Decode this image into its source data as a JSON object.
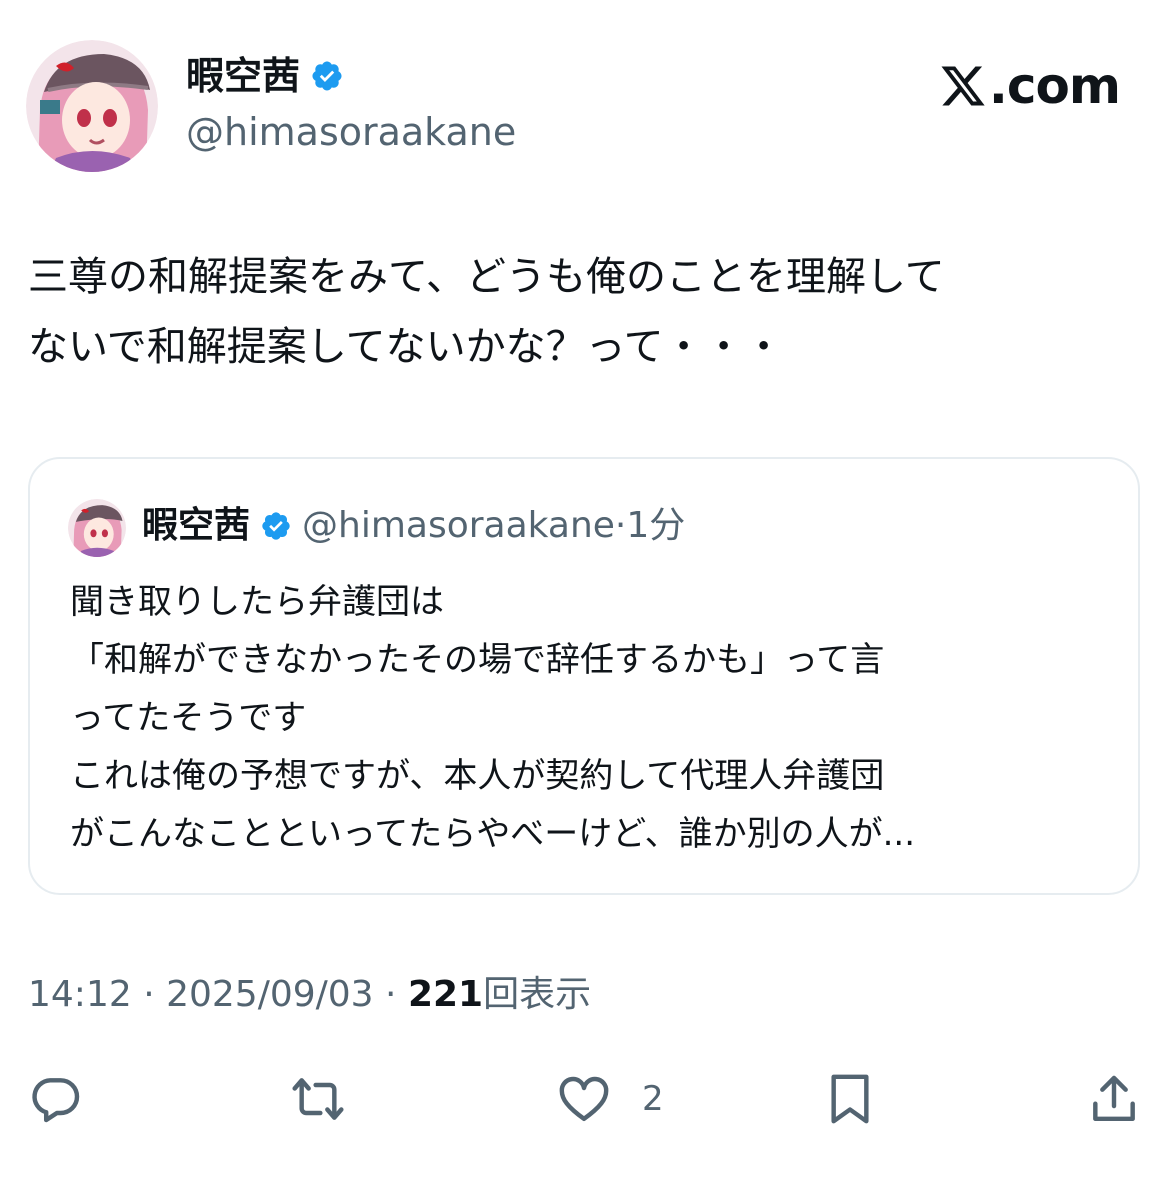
{
  "author": {
    "name": "暇空茜",
    "handle": "@himasoraakane",
    "verified": true,
    "avatar": "anime-girl-avatar"
  },
  "brand": {
    "logo_icon": "x-logo-icon",
    "text": ".com"
  },
  "tweet": {
    "text": "三尊の和解提案をみて、どうも俺のことを理解して\nないで和解提案してないかな？って・・・"
  },
  "quote": {
    "name": "暇空茜",
    "handle": "@himasoraakane",
    "separator": "·",
    "time": "1分",
    "body": "聞き取りしたら弁護団は\n「和解ができなかったその場で辞任するかも」って言\nってたそうです\nこれは俺の予想ですが、本人が契約して代理人弁護団\nがこんなことといってたらやべーけど、誰か別の人が..."
  },
  "meta": {
    "time": "14:12",
    "sep1": " · ",
    "date": "2025/09/03",
    "sep2": " · ",
    "views": "221",
    "views_label": "回表示"
  },
  "actions": {
    "reply_icon": "reply-icon",
    "repost_icon": "repost-icon",
    "like_icon": "heart-icon",
    "like_count": "2",
    "bookmark_icon": "bookmark-icon",
    "share_icon": "share-icon"
  },
  "colors": {
    "verified_blue": "#1d9bf0",
    "secondary_text": "#536471",
    "border": "#e6ecf0"
  }
}
